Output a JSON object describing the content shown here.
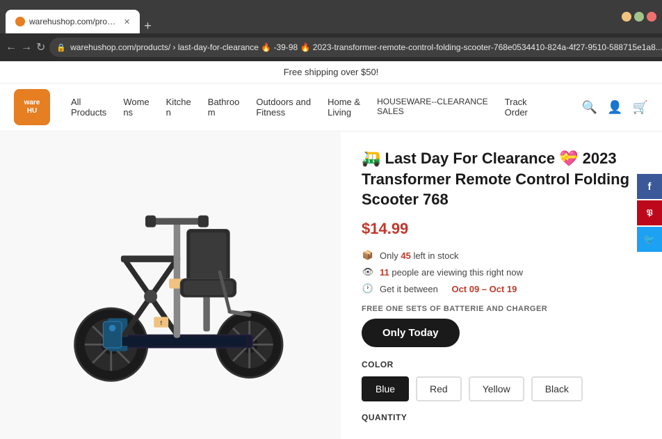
{
  "browser": {
    "tab_title": "warehushop.com/products/...",
    "tab_favicon": "🛒",
    "url": "warehushop.com/products/ › last-day-for-clearance 🔥 -39-98 🔥 2023-transformer-remote-control-folding-scooter-768e0534410-824a-4f27-9510-588715e1a8...",
    "url_short": "warehushop.com/products/ › last-day-for-clearance 🔥 -39-98 🔥 2023-transformer-remote-control-folding-scooter-768e0534410-824a-4f27-9510-588715e1a8...",
    "back_disabled": false,
    "forward_disabled": false
  },
  "free_shipping": {
    "text": "Free shipping over $50!"
  },
  "header": {
    "logo_text": "WarehU",
    "nav_items": [
      {
        "label": "All Products",
        "id": "all-products"
      },
      {
        "label": "Womens",
        "id": "womens"
      },
      {
        "label": "Kitchen",
        "id": "kitchen"
      },
      {
        "label": "Bathroom",
        "id": "bathroom"
      },
      {
        "label": "Outdoors and Fitness",
        "id": "outdoors"
      },
      {
        "label": "Home & Living",
        "id": "home"
      },
      {
        "label": "HOUSEWARE--CLEARANCE SALES",
        "id": "houseware"
      },
      {
        "label": "Track Order",
        "id": "track"
      }
    ]
  },
  "product": {
    "title": "🛺 Last Day For Clearance 💝 2023 Transformer Remote Control Folding Scooter 768",
    "price": "$14.99",
    "stock_count": "45",
    "stock_text": "left in stock",
    "viewers_count": "11",
    "viewers_text": "people are viewing this right now",
    "delivery_text": "Get it between",
    "delivery_dates": "Oct 09 – Oct 19",
    "free_offer_label": "FREE ONE SETS OF BATTERIE AND CHARGER",
    "only_today_btn": "Only Today",
    "color_label": "COLOR",
    "colors": [
      {
        "label": "Blue",
        "selected": true
      },
      {
        "label": "Red",
        "selected": false
      },
      {
        "label": "Yellow",
        "selected": false
      },
      {
        "label": "Black",
        "selected": false
      }
    ],
    "quantity_label": "Quantity"
  },
  "social": {
    "facebook_label": "f",
    "pinterest_label": "P",
    "twitter_label": "t"
  }
}
